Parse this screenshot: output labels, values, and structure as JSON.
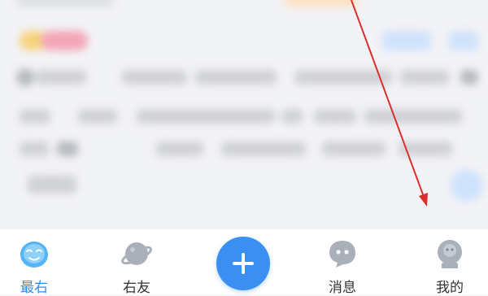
{
  "tabbar": {
    "tabs": [
      {
        "label": "最右",
        "icon": "mascot-face-icon",
        "active": true
      },
      {
        "label": "右友",
        "icon": "planet-icon",
        "active": false
      },
      {
        "label": "",
        "icon": "plus-icon",
        "active": false
      },
      {
        "label": "消息",
        "icon": "chat-bubble-icon",
        "active": false
      },
      {
        "label": "我的",
        "icon": "profile-icon",
        "active": false
      }
    ]
  },
  "colors": {
    "accent": "#2d8cf0",
    "post_button": "#3b8ff3",
    "inactive_icon": "#aab0ba",
    "arrow": "#d9302c"
  }
}
